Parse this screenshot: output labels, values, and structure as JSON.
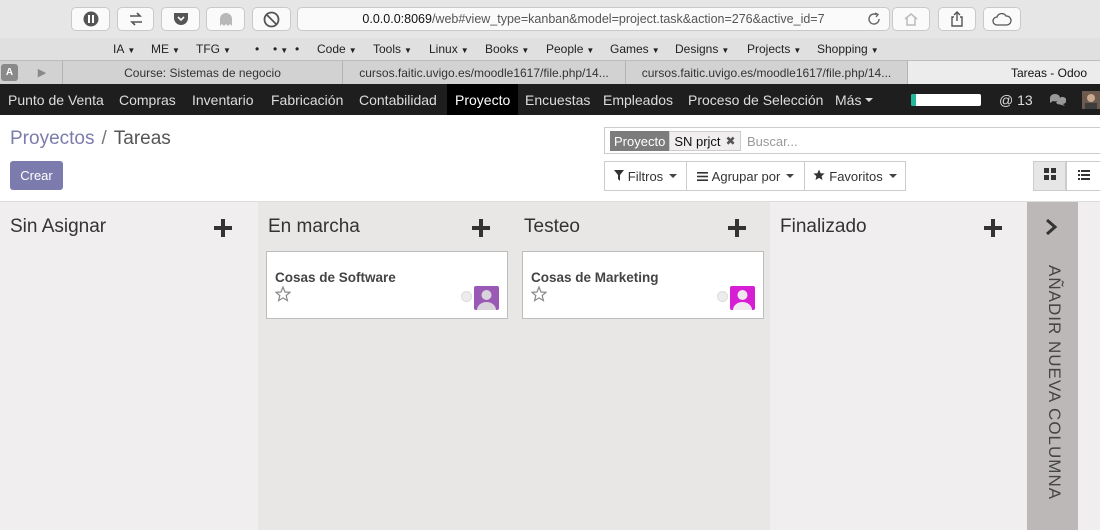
{
  "browser": {
    "url_host": "0.0.0.0:8069",
    "url_path": "/web#view_type=kanban&model=project.task&action=276&active_id=7",
    "bookmarks": [
      {
        "label": "IA",
        "has_menu": true
      },
      {
        "label": "ME",
        "has_menu": true
      },
      {
        "label": "TFG",
        "has_menu": true
      },
      {
        "label": "•",
        "has_menu": false
      },
      {
        "label": "•",
        "has_menu": true
      },
      {
        "label": "•",
        "has_menu": false
      },
      {
        "label": "Code",
        "has_menu": true
      },
      {
        "label": "Tools",
        "has_menu": true
      },
      {
        "label": "Linux",
        "has_menu": true
      },
      {
        "label": "Books",
        "has_menu": true
      },
      {
        "label": "People",
        "has_menu": true
      },
      {
        "label": "Games",
        "has_menu": true
      },
      {
        "label": "Designs",
        "has_menu": true
      },
      {
        "label": "Projects",
        "has_menu": true
      },
      {
        "label": "Shopping",
        "has_menu": true
      }
    ],
    "pinned_tabs": [
      {
        "icon": "a-icon",
        "glyph": "A"
      },
      {
        "icon": "youtube-icon",
        "glyph": "▶"
      }
    ],
    "tabs": [
      {
        "label": "Course: Sistemas de negocio",
        "active": false
      },
      {
        "label": "cursos.faitic.uvigo.es/moodle1617/file.php/14...",
        "active": false
      },
      {
        "label": "cursos.faitic.uvigo.es/moodle1617/file.php/14...",
        "active": false
      },
      {
        "label": "Tareas - Odoo",
        "active": true
      }
    ]
  },
  "nav": {
    "items": [
      {
        "label": "Punto de Venta"
      },
      {
        "label": "Compras"
      },
      {
        "label": "Inventario"
      },
      {
        "label": "Fabricación"
      },
      {
        "label": "Contabilidad"
      },
      {
        "label": "Proyecto",
        "active": true
      },
      {
        "label": "Encuestas"
      },
      {
        "label": "Empleados"
      },
      {
        "label": "Proceso de Selección"
      },
      {
        "label": "Más"
      }
    ],
    "progress": 0.07,
    "mentions": "@ 13",
    "accent": "#21b799"
  },
  "breadcrumb": {
    "parent": "Proyectos",
    "separator": "/",
    "current": "Tareas"
  },
  "actions": {
    "create": "Crear"
  },
  "search": {
    "facet_category": "Proyecto",
    "facet_value": "SN prjct",
    "placeholder": "Buscar...",
    "filters": "Filtros",
    "group_by": "Agrupar por",
    "favorites": "Favoritos"
  },
  "kanban": {
    "columns": [
      {
        "title": "Sin Asignar",
        "cards": []
      },
      {
        "title": "En marcha",
        "cards": [
          {
            "title": "Cosas de Software",
            "avatar_color": "#9b59b6"
          }
        ]
      },
      {
        "title": "Testeo",
        "cards": [
          {
            "title": "Cosas de Marketing",
            "avatar_color": "#d81ed4"
          }
        ]
      },
      {
        "title": "Finalizado",
        "cards": []
      }
    ],
    "add_column": "AÑADIR NUEVA COLUMNA"
  },
  "colors": {
    "brand": "#7c7bad",
    "nav_bg": "#1e1e1e",
    "kanban_bg": "#f0eeee",
    "column_alt_bg": "#e9e6e6"
  }
}
